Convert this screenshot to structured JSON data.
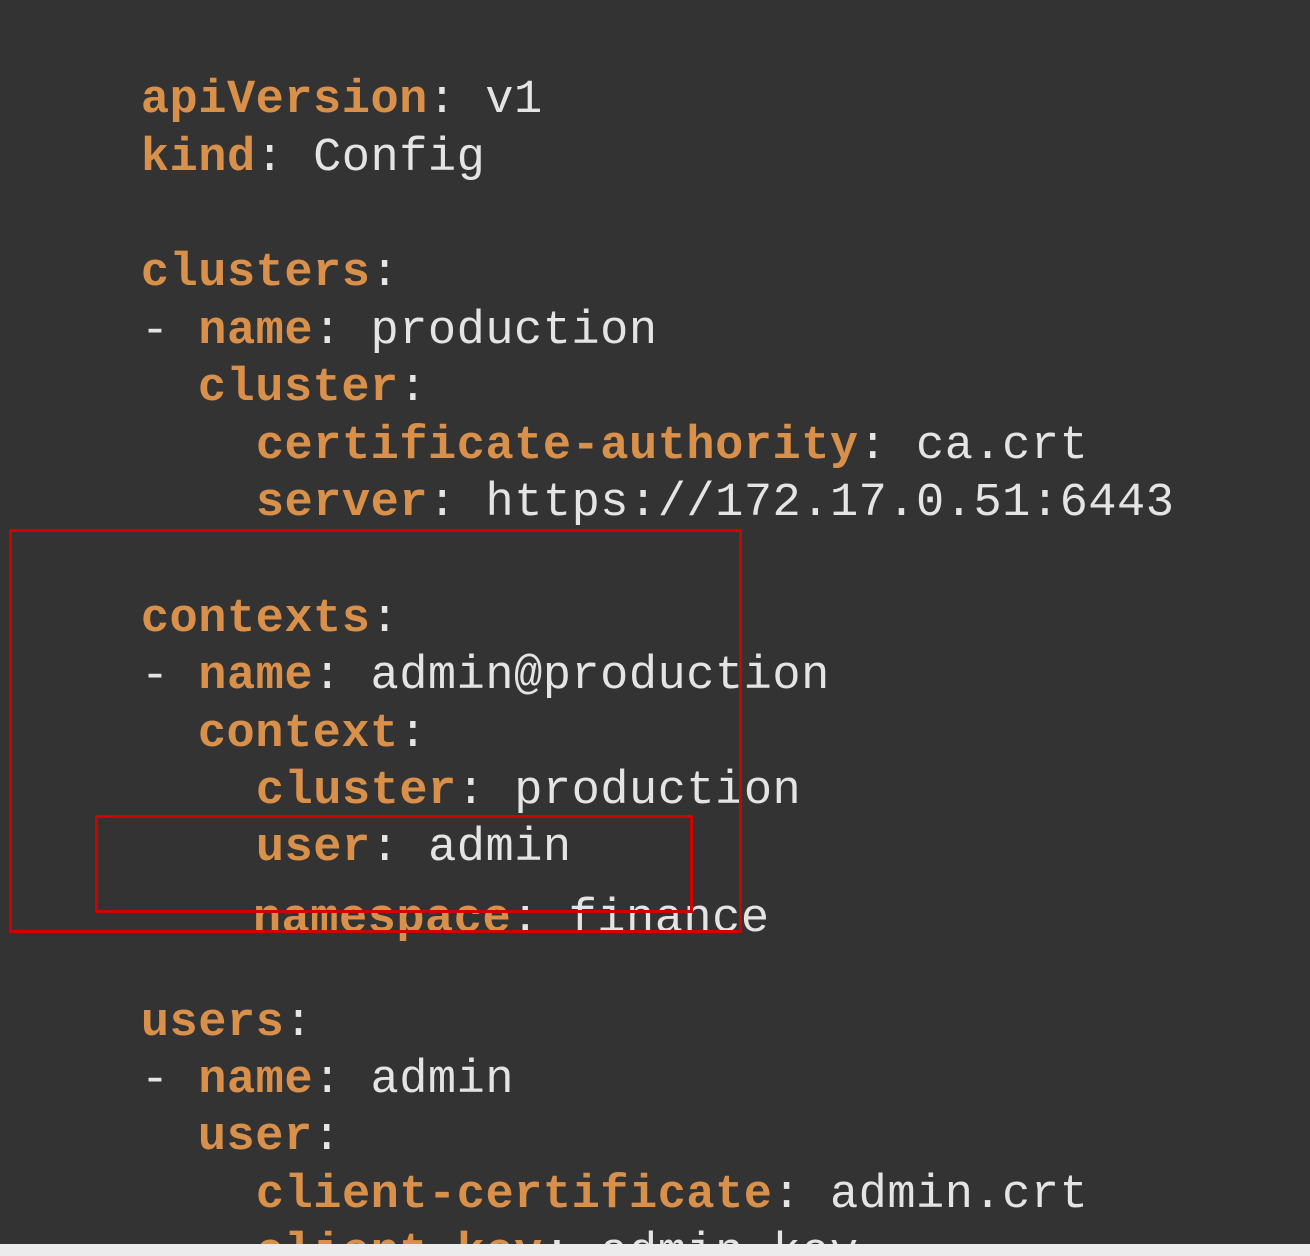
{
  "editor": {
    "background": "#333333",
    "key_color": "#d9904a",
    "value_color": "#e4e4e4",
    "highlight_color": "#d40000",
    "lines": [
      {
        "key": "apiVersion",
        "value": "v1"
      },
      {
        "key": "kind",
        "value": "Config"
      },
      {
        "key": "clusters",
        "value": ""
      },
      {
        "dash": "- ",
        "key": "name",
        "value": "production"
      },
      {
        "key": "cluster",
        "value": ""
      },
      {
        "key": "certificate-authority",
        "value": "ca.crt"
      },
      {
        "key": "server",
        "value": "https://172.17.0.51:6443"
      },
      {
        "key": "contexts",
        "value": ""
      },
      {
        "dash": "- ",
        "key": "name",
        "value": "admin@production"
      },
      {
        "key": "context",
        "value": ""
      },
      {
        "key": "cluster",
        "value": "production"
      },
      {
        "key": "user",
        "value": "admin"
      },
      {
        "key": "namespace",
        "value": "finance"
      },
      {
        "key": "users",
        "value": ""
      },
      {
        "dash": "- ",
        "key": "name",
        "value": "admin"
      },
      {
        "key": "user",
        "value": ""
      },
      {
        "key": "client-certificate",
        "value": "admin.crt"
      },
      {
        "key": "client-key",
        "value": "admin.key"
      }
    ]
  }
}
